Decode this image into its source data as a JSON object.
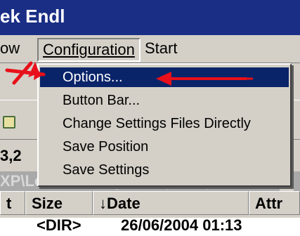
{
  "window": {
    "title": "ek Endl"
  },
  "menubar": {
    "items": [
      {
        "label": "ow"
      },
      {
        "label": "Configuration"
      },
      {
        "label": "Start"
      }
    ]
  },
  "dropdown": {
    "items": [
      {
        "label": "Options...",
        "selected": true
      },
      {
        "label": "Button Bar...",
        "selected": false
      },
      {
        "label": "Change Settings Files Directly",
        "selected": false
      },
      {
        "label": "Save Position",
        "selected": false
      },
      {
        "label": "Save Settings",
        "selected": false
      }
    ]
  },
  "drive": {
    "text": "3,2"
  },
  "path": {
    "text": "XP\\Local Settings\\Temporary",
    "star": "*"
  },
  "columns": [
    {
      "label": "t"
    },
    {
      "label": "Size"
    },
    {
      "label": "↓Date"
    },
    {
      "label": "Attr"
    }
  ],
  "row": {
    "size": "<DIR>",
    "date": "26/06/2004 01:13"
  },
  "colors": {
    "titlebar": "#1a2e85",
    "selection": "#0a246a",
    "annotation": "#e8101a",
    "face": "#d4d0c8"
  },
  "icons": [
    "folder-icon",
    "arrow-annotation-icon"
  ]
}
